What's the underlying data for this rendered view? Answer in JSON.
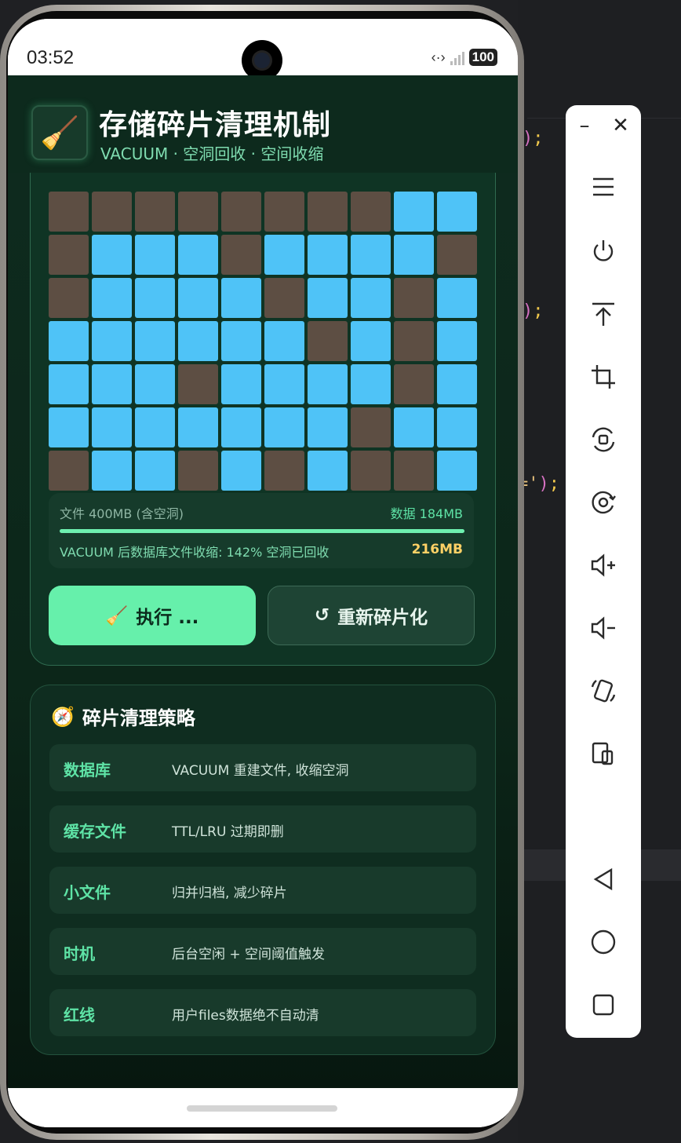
{
  "status_bar": {
    "time": "03:52",
    "battery": "100"
  },
  "header": {
    "logo_emoji": "🧹",
    "title": "存储碎片清理机制",
    "subtitle": "VACUUM · 空洞回收 · 空间收缩"
  },
  "grid": {
    "rows": [
      [
        0,
        0,
        0,
        0,
        0,
        0,
        0,
        0,
        1,
        1
      ],
      [
        0,
        1,
        1,
        1,
        0,
        1,
        1,
        1,
        1,
        0
      ],
      [
        0,
        1,
        1,
        1,
        1,
        0,
        1,
        1,
        0,
        1
      ],
      [
        1,
        1,
        1,
        1,
        1,
        1,
        0,
        1,
        0,
        1
      ],
      [
        1,
        1,
        1,
        0,
        1,
        1,
        1,
        1,
        0,
        1
      ],
      [
        1,
        1,
        1,
        1,
        1,
        1,
        1,
        0,
        1,
        1
      ],
      [
        0,
        1,
        1,
        0,
        1,
        0,
        1,
        0,
        0,
        1
      ]
    ],
    "colors": {
      "full": "#4fc3f7",
      "empty": "#5d4e43"
    }
  },
  "stats": {
    "file_label": "文件 400MB (含空洞)",
    "data_label": "数据 184MB",
    "progress": 1.0,
    "message": "VACUUM 后数据库文件收缩: 142% 空洞已回收",
    "saved": "216MB"
  },
  "buttons": {
    "execute_icon": "🧹",
    "execute_label": "执行 ...",
    "refrag_icon": "↺",
    "refrag_label": "重新碎片化"
  },
  "strategy": {
    "icon": "🧭",
    "title": "碎片清理策略",
    "items": [
      {
        "key": "数据库",
        "value": "VACUUM 重建文件, 收缩空洞"
      },
      {
        "key": "缓存文件",
        "value": "TTL/LRU 过期即删"
      },
      {
        "key": "小文件",
        "value": "归并归档, 减少碎片"
      },
      {
        "key": "时机",
        "value": "后台空闲 + 空间阈值触发"
      },
      {
        "key": "红线",
        "value": "用户files数据绝不自动清"
      }
    ]
  },
  "toolbar_icons": [
    "menu-icon",
    "power-icon",
    "pin-top-icon",
    "crop-icon",
    "screenshot-icon",
    "screen-record-icon",
    "volume-up-icon",
    "volume-down-icon",
    "rotate-icon",
    "fold-icon",
    "back-icon",
    "home-icon",
    "overview-icon"
  ],
  "theme": {
    "accent": "#66f0ab",
    "background": "#0c2619"
  }
}
